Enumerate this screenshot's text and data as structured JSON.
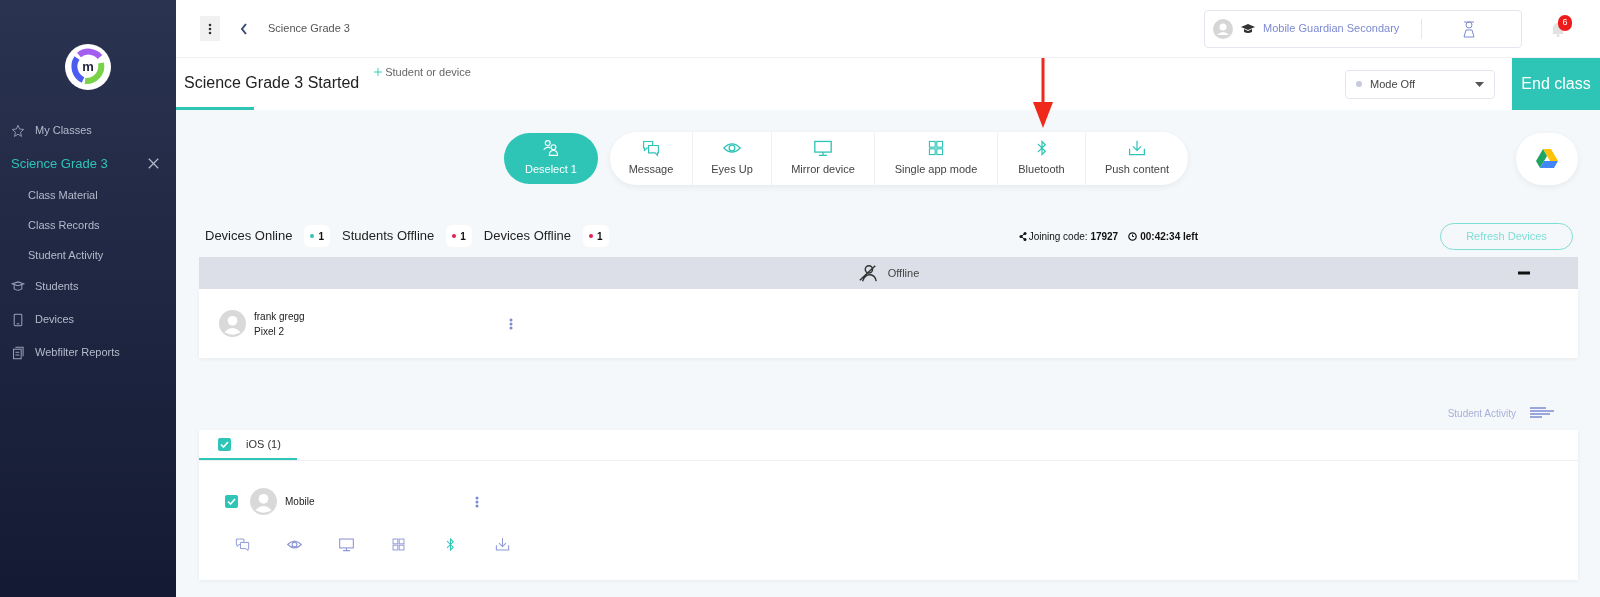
{
  "sidebar": {
    "logo": "m",
    "items": [
      {
        "label": "My Classes",
        "kind": "star",
        "selected": false
      },
      {
        "label": "Science Grade 3",
        "kind": "class",
        "selected": true,
        "children": [
          {
            "label": "Class Material",
            "selected": false
          },
          {
            "label": "Class Records",
            "selected": false
          },
          {
            "label": "Student Activity",
            "selected": false
          }
        ]
      },
      {
        "label": "Students",
        "kind": "cap",
        "selected": false
      },
      {
        "label": "Devices",
        "kind": "phone",
        "selected": false
      },
      {
        "label": "Webfilter Reports",
        "kind": "report",
        "selected": false
      }
    ]
  },
  "topbar": {
    "breadcrumb": "Science Grade 3",
    "account": "Mobile Guardian Secondary",
    "notifications": "6"
  },
  "header": {
    "title": "Science Grade 3 Started",
    "add_label": "Student or device",
    "mode": "Mode Off",
    "end_button": "End class"
  },
  "toolbar": {
    "deselect": "Deselect 1",
    "actions": [
      {
        "label": "Message",
        "kind": "message"
      },
      {
        "label": "Eyes Up",
        "kind": "eye"
      },
      {
        "label": "Mirror device",
        "kind": "monitor"
      },
      {
        "label": "Single app mode",
        "kind": "grid"
      },
      {
        "label": "Bluetooth",
        "kind": "bluetooth"
      },
      {
        "label": "Push content",
        "kind": "download"
      }
    ]
  },
  "stats": [
    {
      "label": "Devices Online",
      "count": "1",
      "color": "#2ec4b6"
    },
    {
      "label": "Students Offline",
      "count": "1",
      "color": "#e0234e"
    },
    {
      "label": "Devices Offline",
      "count": "1",
      "color": "#e0234e"
    }
  ],
  "joining": {
    "label": "Joining code:",
    "code": "17927",
    "time": "00:42:34 left"
  },
  "refresh_button": "Refresh Devices",
  "offline_group": {
    "title": "Offline",
    "expanded": true,
    "students": [
      {
        "name": "frank gregg",
        "device": "Pixel 2"
      }
    ]
  },
  "activity_label": "Student Activity",
  "ios_tab": {
    "label": "iOS (1)",
    "checked": true,
    "devices": [
      {
        "name": "Mobile",
        "checked": true,
        "actions": [
          {
            "kind": "message",
            "active": false
          },
          {
            "kind": "eye",
            "active": false
          },
          {
            "kind": "monitor",
            "active": false
          },
          {
            "kind": "grid",
            "active": false
          },
          {
            "kind": "bluetooth",
            "active": true
          },
          {
            "kind": "download",
            "active": false
          }
        ]
      }
    ]
  }
}
